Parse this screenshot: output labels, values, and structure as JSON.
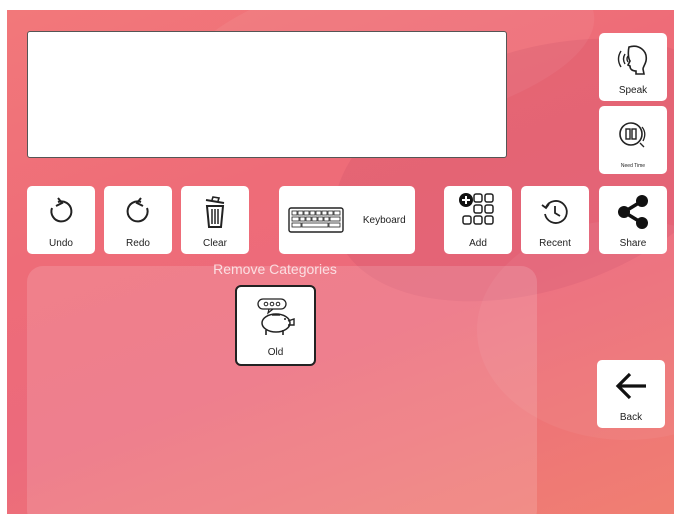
{
  "message_box": {
    "text": ""
  },
  "side_buttons": {
    "speak_label": "Speak",
    "need_time_label": "Need Time"
  },
  "toolbar": {
    "undo_label": "Undo",
    "redo_label": "Redo",
    "clear_label": "Clear",
    "keyboard_label": "Keyboard",
    "add_label": "Add",
    "recent_label": "Recent",
    "share_label": "Share"
  },
  "categories_panel": {
    "title": "Remove Categories",
    "items": [
      {
        "label": "Old",
        "icon": "piggy-bank-speech-icon"
      }
    ]
  },
  "back_button": {
    "label": "Back"
  },
  "colors": {
    "background_start": "#f2787a",
    "background_end": "#ec6a7c",
    "tile": "#ffffff"
  }
}
